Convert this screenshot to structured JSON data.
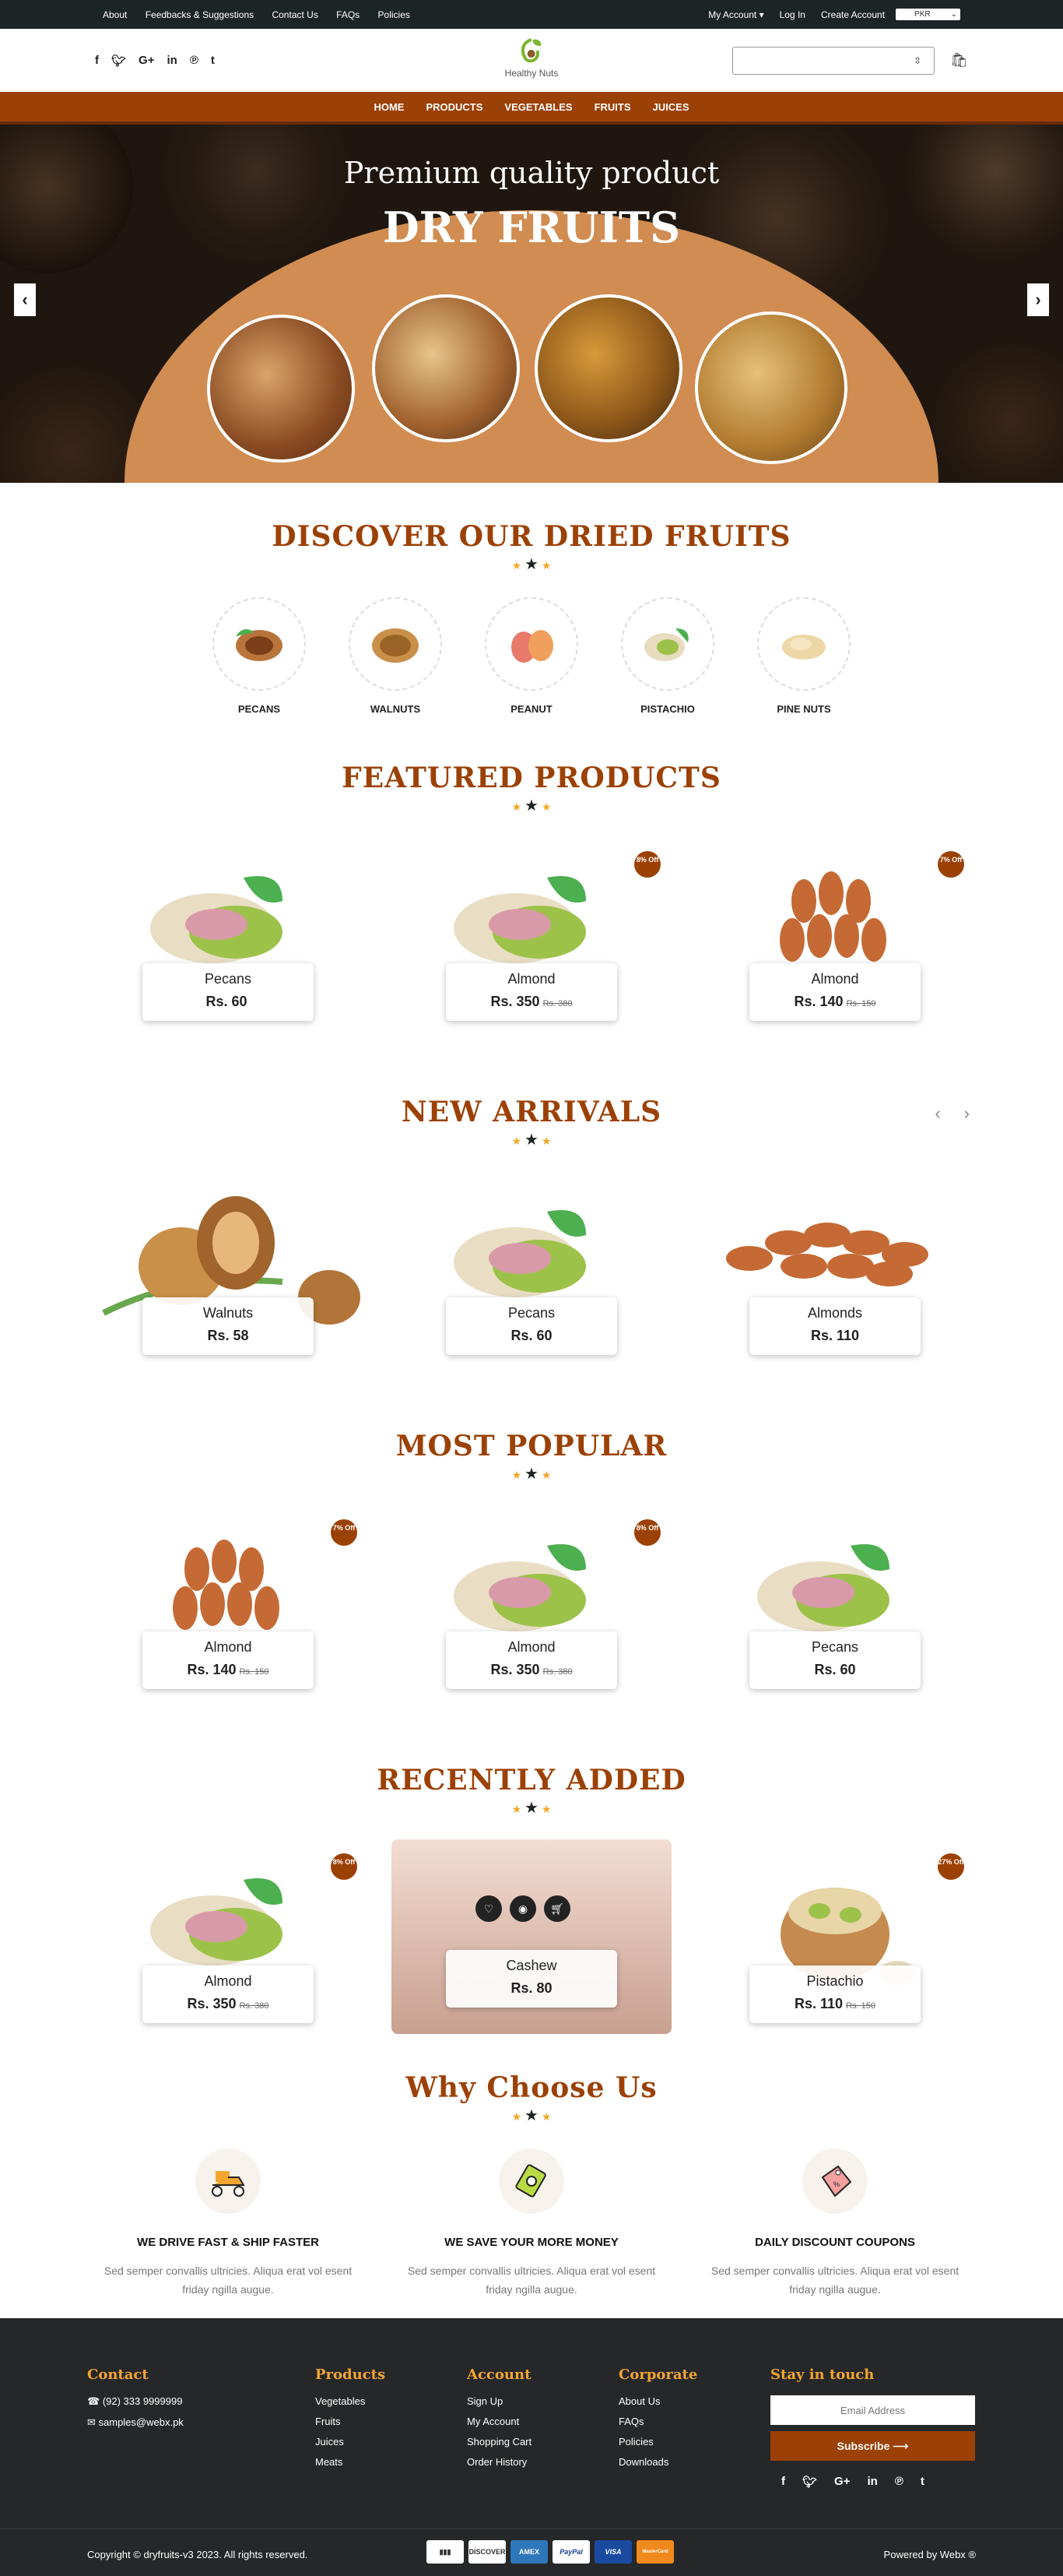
{
  "topbar": {
    "links": [
      "About",
      "Feedbacks & Suggestions",
      "Contact Us",
      "FAQs",
      "Policies"
    ],
    "my_account": "My Account",
    "login": "Log In",
    "create_account": "Create Account",
    "currency": "PKR"
  },
  "header": {
    "logo_text": "Healthy Nuts",
    "search_placeholder": ""
  },
  "nav": [
    "HOME",
    "PRODUCTS",
    "VEGETABLES",
    "FRUITS",
    "JUICES"
  ],
  "hero": {
    "subtitle": "Premium quality product",
    "title": "DRY FRUITS"
  },
  "discover": {
    "title": "DISCOVER OUR DRIED FRUITS",
    "items": [
      "PECANS",
      "WALNUTS",
      "PEANUT",
      "PISTACHIO",
      "PINE NUTS"
    ]
  },
  "featured": {
    "title": "FEATURED PRODUCTS",
    "items": [
      {
        "name": "Pecans",
        "price": "Rs. 60",
        "old": "",
        "badge": ""
      },
      {
        "name": "Almond",
        "price": "Rs. 350",
        "old": "Rs. 380",
        "badge": "8% Off"
      },
      {
        "name": "Almond",
        "price": "Rs. 140",
        "old": "Rs. 150",
        "badge": "7% Off"
      }
    ]
  },
  "new_arrivals": {
    "title": "NEW ARRIVALS",
    "items": [
      {
        "name": "Walnuts",
        "price": "Rs. 58",
        "old": "",
        "badge": ""
      },
      {
        "name": "Pecans",
        "price": "Rs. 60",
        "old": "",
        "badge": ""
      },
      {
        "name": "Almonds",
        "price": "Rs. 110",
        "old": "",
        "badge": ""
      }
    ]
  },
  "popular": {
    "title": "MOST POPULAR",
    "items": [
      {
        "name": "Almond",
        "price": "Rs. 140",
        "old": "Rs. 150",
        "badge": "7% Off"
      },
      {
        "name": "Almond",
        "price": "Rs. 350",
        "old": "Rs. 380",
        "badge": "8% Off"
      },
      {
        "name": "Pecans",
        "price": "Rs. 60",
        "old": "",
        "badge": ""
      }
    ]
  },
  "recent": {
    "title": "RECENTLY ADDED",
    "items": [
      {
        "name": "Almond",
        "price": "Rs. 350",
        "old": "Rs. 380",
        "badge": "8% Off"
      },
      {
        "name": "Cashew",
        "price": "Rs. 80",
        "old": "",
        "badge": ""
      },
      {
        "name": "Pistachio",
        "price": "Rs. 110",
        "old": "Rs. 150",
        "badge": "27% Off"
      }
    ]
  },
  "why": {
    "title": "Why Choose Us",
    "items": [
      {
        "title": "WE DRIVE FAST & SHIP FASTER",
        "text": "Sed semper convallis ultricies. Aliqua erat vol esent friday ngilla augue."
      },
      {
        "title": "WE SAVE YOUR MORE MONEY",
        "text": "Sed semper convallis ultricies. Aliqua erat vol esent friday ngilla augue."
      },
      {
        "title": "DAILY DISCOUNT COUPONS",
        "text": "Sed semper convallis ultricies. Aliqua erat vol esent friday ngilla augue."
      }
    ]
  },
  "footer": {
    "contact": {
      "title": "Contact",
      "phone": "(92) 333 9999999",
      "email": "samples@webx.pk"
    },
    "products": {
      "title": "Products",
      "items": [
        "Vegetables",
        "Fruits",
        "Juices",
        "Meats"
      ]
    },
    "account": {
      "title": "Account",
      "items": [
        "Sign Up",
        "My Account",
        "Shopping Cart",
        "Order History"
      ]
    },
    "corporate": {
      "title": "Corporate",
      "items": [
        "About Us",
        "FAQs",
        "Policies",
        "Downloads"
      ]
    },
    "touch": {
      "title": "Stay in touch",
      "email_placeholder": "Email Address",
      "subscribe": "Subscribe ⟶"
    },
    "payments": [
      "DISCOVER",
      "AMEX",
      "PayPal",
      "VISA",
      "MasterCard"
    ],
    "copyright": "Copyright © dryfruits-v3 2023. All rights reserved.",
    "powered": "Powered by Webx ®"
  },
  "colors": {
    "brand": "#9c4106",
    "accent": "#f3a531",
    "dark": "#262728"
  }
}
